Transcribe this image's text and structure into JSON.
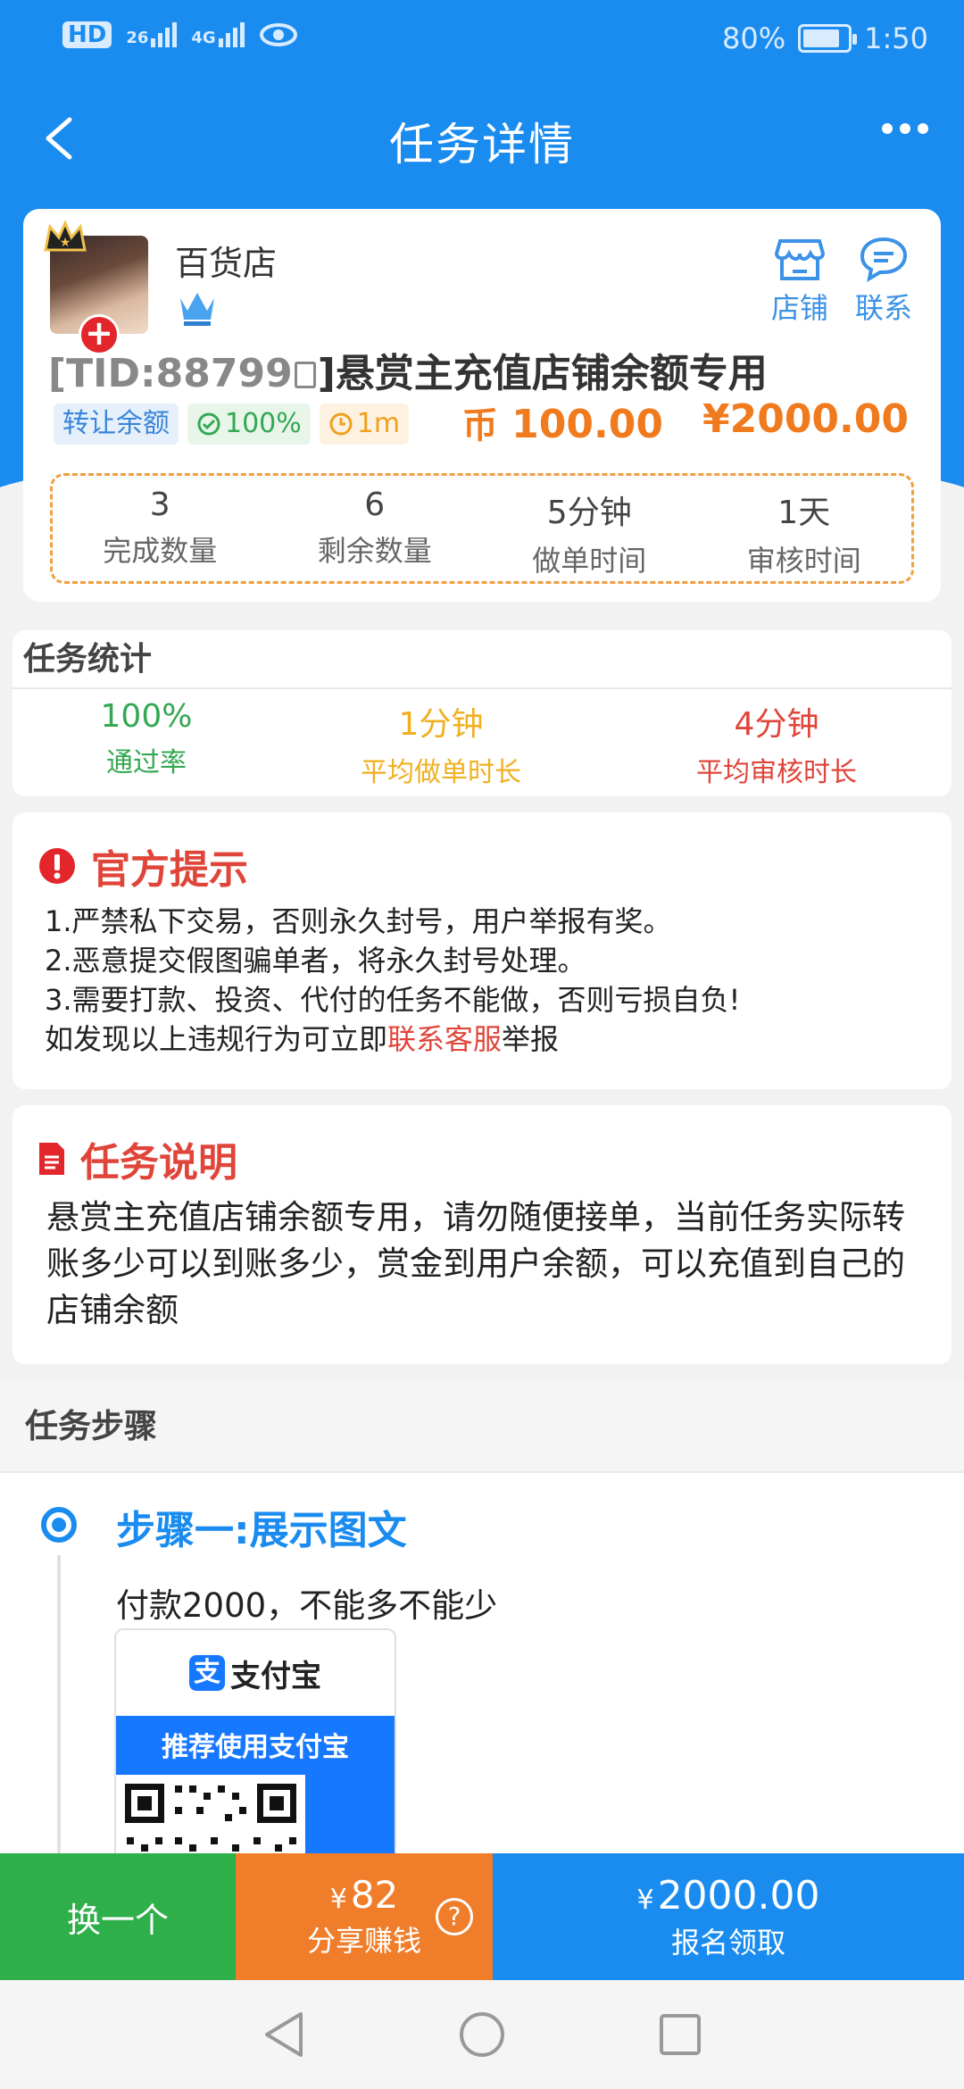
{
  "status_bar": {
    "network_hd": "HD",
    "signal_1": "26",
    "signal_2": "4G",
    "battery": "80%",
    "time": "1:50"
  },
  "header": {
    "title": "任务详情"
  },
  "shop": {
    "name": "百货店",
    "shop_label": "店铺",
    "contact_label": "联系"
  },
  "task": {
    "tid": "[TID:88799",
    "title_rest": "]悬赏主充值店铺余额专用",
    "tags": [
      "转让余额",
      "100%",
      "1m"
    ],
    "coin_symbol": "币",
    "coin_price": "100.00",
    "rmb_price": "¥2000.00"
  },
  "stats": [
    {
      "value": "3",
      "label": "完成数量"
    },
    {
      "value": "6",
      "label": "剩余数量"
    },
    {
      "value": "5分钟",
      "label": "做单时间"
    },
    {
      "value": "1天",
      "label": "审核时间"
    }
  ],
  "task_stats": {
    "heading": "任务统计",
    "pass_rate": "100%",
    "pass_rate_label": "通过率",
    "avg_do": "1分钟",
    "avg_do_label": "平均做单时长",
    "avg_review": "4分钟",
    "avg_review_label": "平均审核时长"
  },
  "notice": {
    "heading": "官方提示",
    "lines": [
      "1.严禁私下交易，否则永久封号，用户举报有奖。",
      "2.恶意提交假图骗单者，将永久封号处理。",
      "3.需要打款、投资、代付的任务不能做，否则亏损自负!"
    ],
    "last_prefix": "如发现以上违规行为可立即",
    "last_link": "联系客服",
    "last_suffix": "举报"
  },
  "description": {
    "heading": "任务说明",
    "text": "悬赏主充值店铺余额专用，请勿随便接单，当前任务实际转账多少可以到账多少，赏金到用户余额，可以充值到自己的店铺余额"
  },
  "steps": {
    "heading": "任务步骤",
    "step1_title": "步骤一:展示图文",
    "step1_desc": "付款2000，不能多不能少",
    "alipay_brand": "支付宝",
    "alipay_mark": "支",
    "alipay_recommend": "推荐使用支付宝"
  },
  "bottom_bar": {
    "swap_label": "换一个",
    "share_amount": "82",
    "share_label": "分享赚钱",
    "sign_amount": "2000.00",
    "sign_label": "报名领取",
    "currency": "¥",
    "help": "?"
  },
  "colors": {
    "primary": "#1a8cf0",
    "orange": "#f07d2a",
    "green": "#2faf4a",
    "red": "#e0453a"
  }
}
